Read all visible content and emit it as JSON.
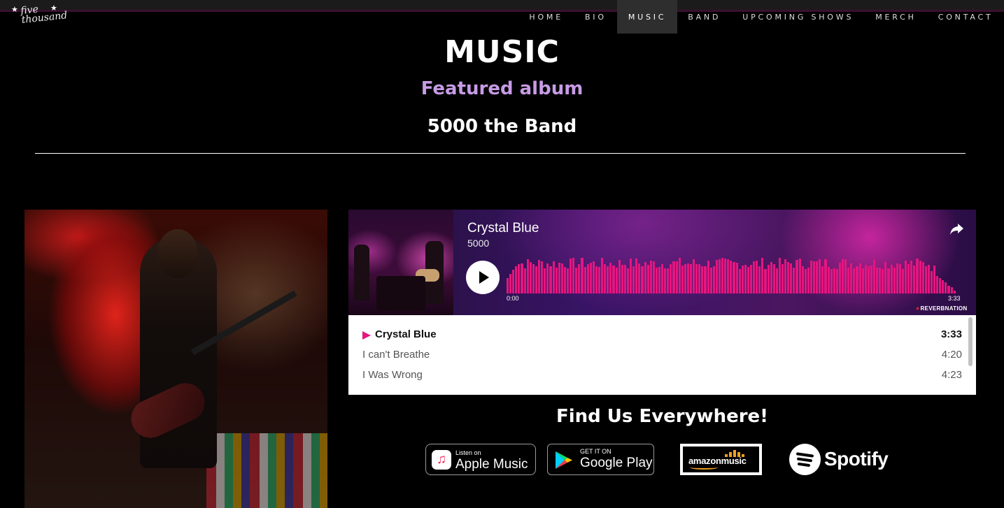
{
  "site": {
    "logo_text": "five thousand"
  },
  "nav": {
    "items": [
      {
        "label": "HOME"
      },
      {
        "label": "BIO"
      },
      {
        "label": "MUSIC",
        "active": true
      },
      {
        "label": "BAND"
      },
      {
        "label": "UPCOMING SHOWS"
      },
      {
        "label": "MERCH"
      },
      {
        "label": "CONTACT"
      }
    ]
  },
  "header": {
    "title": "MUSIC",
    "subtitle": "Featured album",
    "album": "5000 the Band"
  },
  "player": {
    "track_title": "Crystal Blue",
    "artist": "5000",
    "time_start": "0:00",
    "time_end": "3:33",
    "progress": 0,
    "brand": "REVERBNATION",
    "accent_color": "#e6157f",
    "icons": {
      "share": "share-icon",
      "play": "play-icon"
    }
  },
  "tracklist": [
    {
      "name": "Crystal Blue",
      "duration": "3:33",
      "current": true
    },
    {
      "name": "I can't Breathe",
      "duration": "4:20"
    },
    {
      "name": "I Was Wrong",
      "duration": "4:23"
    }
  ],
  "find_us": {
    "heading": "Find Us Everywhere!",
    "apple": {
      "small": "Listen on",
      "big": "Apple Music"
    },
    "google": {
      "small": "GET IT ON",
      "big": "Google Play"
    },
    "amazon": {
      "label": "amazonmusic"
    },
    "spotify": {
      "label": "Spotify"
    }
  },
  "colors": {
    "subtitle": "#c79be6",
    "background": "#000000",
    "accent": "#e6157f"
  }
}
